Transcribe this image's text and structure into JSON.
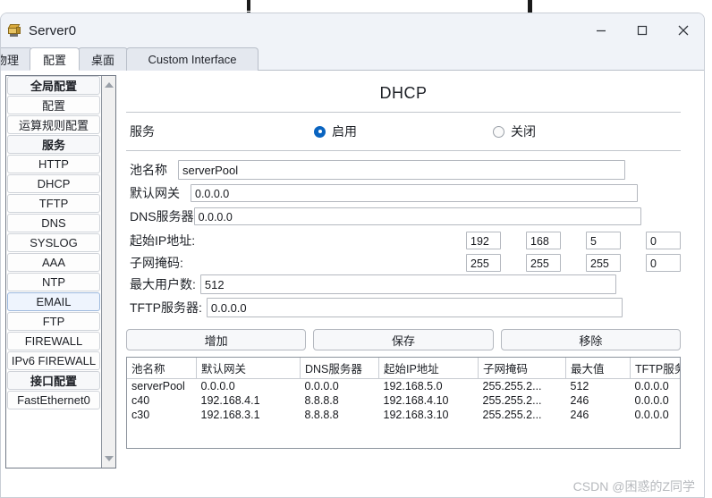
{
  "window": {
    "title": "Server0",
    "icon": "server-icon",
    "controls": {
      "minimize": "minimize-icon",
      "maximize": "maximize-icon",
      "close": "close-icon"
    }
  },
  "tabs": [
    {
      "label": "物理",
      "active": false
    },
    {
      "label": "配置",
      "active": true
    },
    {
      "label": "桌面",
      "active": false
    },
    {
      "label": "Custom Interface",
      "active": false
    }
  ],
  "sidebar": {
    "items": [
      {
        "label": "全局配置",
        "type": "header"
      },
      {
        "label": "配置",
        "type": "item"
      },
      {
        "label": "运算规则配置",
        "type": "item"
      },
      {
        "label": "服务",
        "type": "header"
      },
      {
        "label": "HTTP",
        "type": "item"
      },
      {
        "label": "DHCP",
        "type": "item"
      },
      {
        "label": "TFTP",
        "type": "item"
      },
      {
        "label": "DNS",
        "type": "item"
      },
      {
        "label": "SYSLOG",
        "type": "item"
      },
      {
        "label": "AAA",
        "type": "item"
      },
      {
        "label": "NTP",
        "type": "item"
      },
      {
        "label": "EMAIL",
        "type": "item",
        "selected": true
      },
      {
        "label": "FTP",
        "type": "item"
      },
      {
        "label": "FIREWALL",
        "type": "item"
      },
      {
        "label": "IPv6 FIREWALL",
        "type": "item"
      },
      {
        "label": "接口配置",
        "type": "header"
      },
      {
        "label": "FastEthernet0",
        "type": "item"
      }
    ],
    "scrollbar": {
      "up": "scroll-up-arrow",
      "down": "scroll-down-arrow"
    }
  },
  "panel": {
    "title": "DHCP",
    "service": {
      "label": "服务",
      "on_label": "启用",
      "off_label": "关闭",
      "selected": "on"
    },
    "fields": {
      "pool_name_label": "池名称",
      "pool_name_value": "serverPool",
      "gateway_label": "默认网关",
      "gateway_value": "0.0.0.0",
      "dns_label": "DNS服务器",
      "dns_value": "0.0.0.0",
      "start_ip_label": "起始IP地址:",
      "start_ip_octets": [
        "192",
        "168",
        "5",
        "0"
      ],
      "subnet_label": "子网掩码:",
      "subnet_octets": [
        "255",
        "255",
        "255",
        "0"
      ],
      "max_users_label": "最大用户数:",
      "max_users_value": "512",
      "tftp_label": "TFTP服务器:",
      "tftp_value": "0.0.0.0"
    },
    "buttons": {
      "add": "增加",
      "save": "保存",
      "remove": "移除"
    },
    "table": {
      "columns": [
        "池名称",
        "默认网关",
        "DNS服务器",
        "起始IP地址",
        "子网掩码",
        "最大值",
        "TFTP服务"
      ],
      "rows": [
        [
          "serverPool",
          "0.0.0.0",
          "0.0.0.0",
          "192.168.5.0",
          "255.255.2...",
          "512",
          "0.0.0.0"
        ],
        [
          "c40",
          "192.168.4.1",
          "8.8.8.8",
          "192.168.4.10",
          "255.255.2...",
          "246",
          "0.0.0.0"
        ],
        [
          "c30",
          "192.168.3.1",
          "8.8.8.8",
          "192.168.3.10",
          "255.255.2...",
          "246",
          "0.0.0.0"
        ]
      ]
    }
  },
  "watermark": "CSDN @困惑的Z同学",
  "colors": {
    "accent": "#0a64c0",
    "window_bg": "#f0f3f8",
    "border": "#b4b8bf"
  }
}
